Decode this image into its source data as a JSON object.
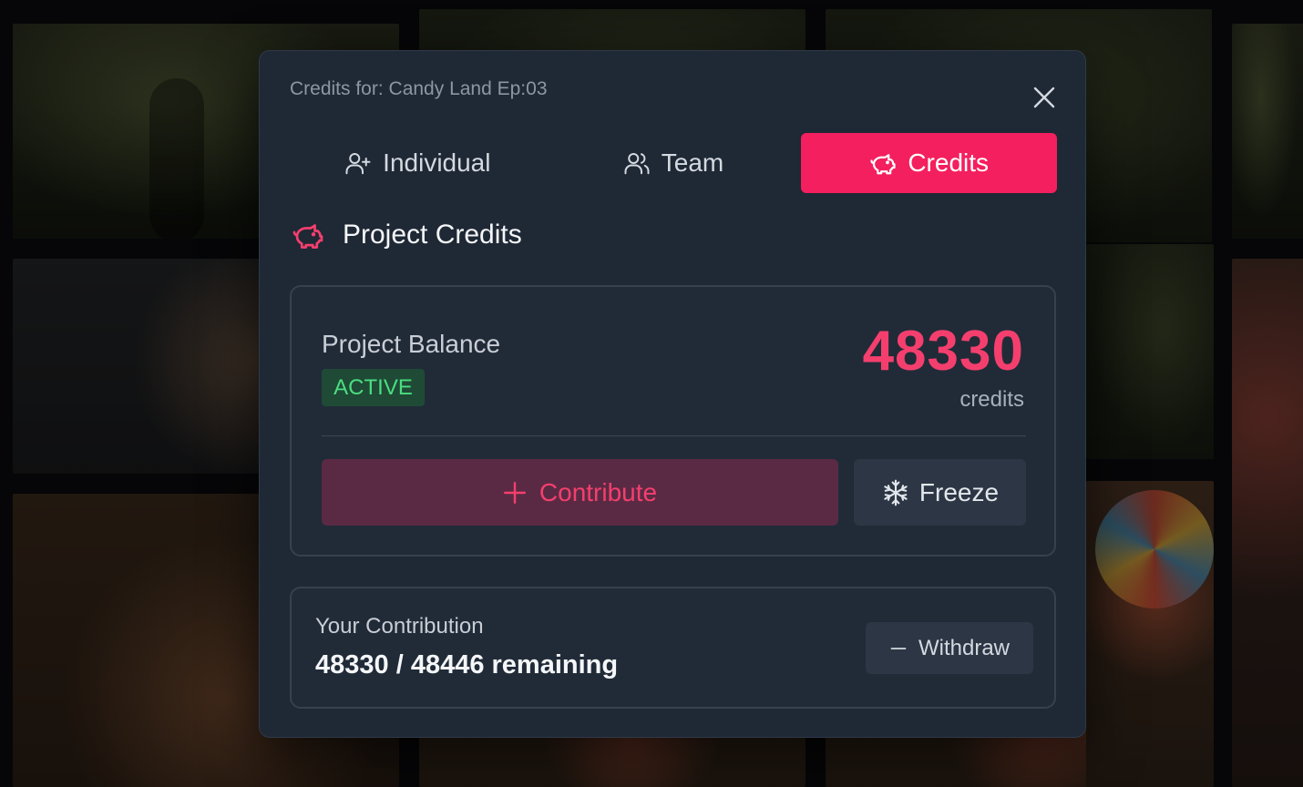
{
  "modal": {
    "title": "Credits for: Candy Land Ep:03",
    "close_icon": "close-icon"
  },
  "tabs": [
    {
      "label": "Individual",
      "icon": "user-plus-icon",
      "active": false
    },
    {
      "label": "Team",
      "icon": "users-icon",
      "active": false
    },
    {
      "label": "Credits",
      "icon": "piggy-bank-icon",
      "active": true
    }
  ],
  "section": {
    "title": "Project Credits",
    "icon": "piggy-bank-icon"
  },
  "balance": {
    "label": "Project Balance",
    "status": "ACTIVE",
    "amount": "48330",
    "unit": "credits",
    "contribute_label": "Contribute",
    "freeze_label": "Freeze"
  },
  "contribution": {
    "label": "Your Contribution",
    "value": "48330 / 48446 remaining",
    "withdraw_label": "Withdraw"
  },
  "colors": {
    "accent": "#f41f5e",
    "accent_text": "#f43f6e",
    "active_badge_bg": "#1f4a36",
    "active_badge_text": "#4ade80",
    "modal_bg": "#1f2835"
  }
}
